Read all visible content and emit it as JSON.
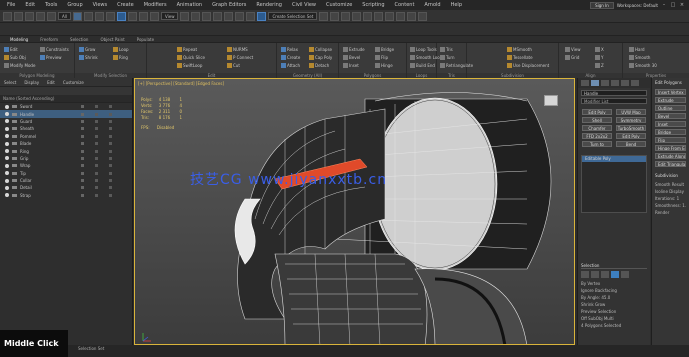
{
  "menu": {
    "items": [
      "File",
      "Edit",
      "Tools",
      "Group",
      "Views",
      "Create",
      "Modifiers",
      "Animation",
      "Graph Editors",
      "Rendering",
      "Civil View",
      "Customize",
      "Scripting",
      "Content",
      "Arnold",
      "Help"
    ],
    "sign_in": "Sign In",
    "workspace": "Workspaces: Default"
  },
  "toolbar": {
    "selection_filter": "All",
    "view_dropdown": "View",
    "selection_set": "Create Selection Set"
  },
  "ribbon": {
    "tabs": [
      "Modeling",
      "Freeform",
      "Selection",
      "Object Paint",
      "Populate"
    ],
    "groups": [
      {
        "label": "Polygon Modeling",
        "buttons": [
          "Edit",
          "Sub Obj",
          "Modify Mode",
          "Constraints",
          "Preview"
        ]
      },
      {
        "label": "Modify Selection",
        "buttons": [
          "Grow",
          "Shrink",
          "Loop",
          "Ring"
        ]
      },
      {
        "label": "Edit",
        "buttons": [
          "Repeat",
          "Quick Slice",
          "SwiftLoop",
          "NURMS",
          "P Connect",
          "Cut"
        ]
      },
      {
        "label": "Geometry (All)",
        "buttons": [
          "Relax",
          "Create",
          "Attach",
          "Collapse",
          "Cap Poly",
          "Detach"
        ]
      },
      {
        "label": "Polygons",
        "buttons": [
          "Extrude",
          "Bevel",
          "Inset",
          "Bridge",
          "Flip",
          "Hinge"
        ]
      },
      {
        "label": "Loops",
        "buttons": [
          "Loop Tools",
          "Smooth Loop",
          "Build End"
        ]
      },
      {
        "label": "Tris",
        "buttons": [
          "Tris",
          "Turn",
          "Retriangulate"
        ]
      },
      {
        "label": "Subdivision",
        "buttons": [
          "MSmooth",
          "Tessellate",
          "Use Displacement"
        ]
      },
      {
        "label": "Align",
        "buttons": [
          "View",
          "Grid",
          "X",
          "Y",
          "Z"
        ]
      },
      {
        "label": "Properties",
        "buttons": [
          "Hard",
          "Smooth",
          "Smooth 30"
        ]
      }
    ]
  },
  "scene_explorer": {
    "tabs": [
      "Select",
      "Display",
      "Edit",
      "Customize"
    ],
    "header": "Name (Sorted Ascending)",
    "rows": [
      {
        "name": "Sword",
        "selected": false
      },
      {
        "name": "Handle",
        "selected": true
      },
      {
        "name": "Guard",
        "selected": false
      },
      {
        "name": "Sheath",
        "selected": false
      },
      {
        "name": "Pommel",
        "selected": false
      },
      {
        "name": "Blade",
        "selected": false
      },
      {
        "name": "Ring",
        "selected": false
      },
      {
        "name": "Grip",
        "selected": false
      },
      {
        "name": "Wrap",
        "selected": false
      },
      {
        "name": "Tip",
        "selected": false
      },
      {
        "name": "Collar",
        "selected": false
      },
      {
        "name": "Detail",
        "selected": false
      },
      {
        "name": "Strap",
        "selected": false
      }
    ]
  },
  "viewport": {
    "label": "[+] [Perspective] [Standard] [Edged Faces]",
    "stats": {
      "labels": [
        "Polys:",
        "Verts:",
        "Faces:",
        "Tris:"
      ],
      "total": [
        "4 138",
        "3 776",
        "2 311",
        "8 176"
      ],
      "selected": [
        "1",
        "4",
        "0",
        "1"
      ],
      "fps_label": "FPS:",
      "fps_value": "Disabled"
    }
  },
  "watermark": "技艺CG  www.jiyanxxtb.cn",
  "status": {
    "middle_click": "Middle Click",
    "text": "Selection Set"
  },
  "command_panel": {
    "object_name": "Handle",
    "modifier_list": "Modifier List",
    "mod_buttons": [
      "Edit Poly",
      "UVW Map",
      "Shell",
      "Symmetry",
      "Chamfer",
      "TurboSmooth",
      "FFD 2x2x2",
      "Edit Poly",
      "Turn to",
      "Bend"
    ],
    "stack_item": "Editable Poly",
    "selection_header": "Selection",
    "by_vertex": "By Vertex",
    "ignore_backfacing": "Ignore Backfacing",
    "by_angle": "By Angle: 45.0",
    "shrink_grow": "Shrink   Grow",
    "preview": "Preview Selection",
    "off_subobj": "Off  SubObj  Multi",
    "selected_count": "4 Polygons Selected"
  },
  "properties_panel": {
    "header": "Edit Polygons",
    "buttons": [
      "Insert Vertex",
      "Extrude",
      "Outline",
      "Bevel",
      "Inset",
      "Bridge",
      "Flip",
      "Hinge From Edge",
      "Extrude Along Spline",
      "Edit Triangulation"
    ],
    "subdivision": "Subdivision",
    "opts": [
      "Smooth Result",
      "Isoline Display",
      "Iterations: 1",
      "Smoothness: 1.0",
      "Render"
    ]
  }
}
